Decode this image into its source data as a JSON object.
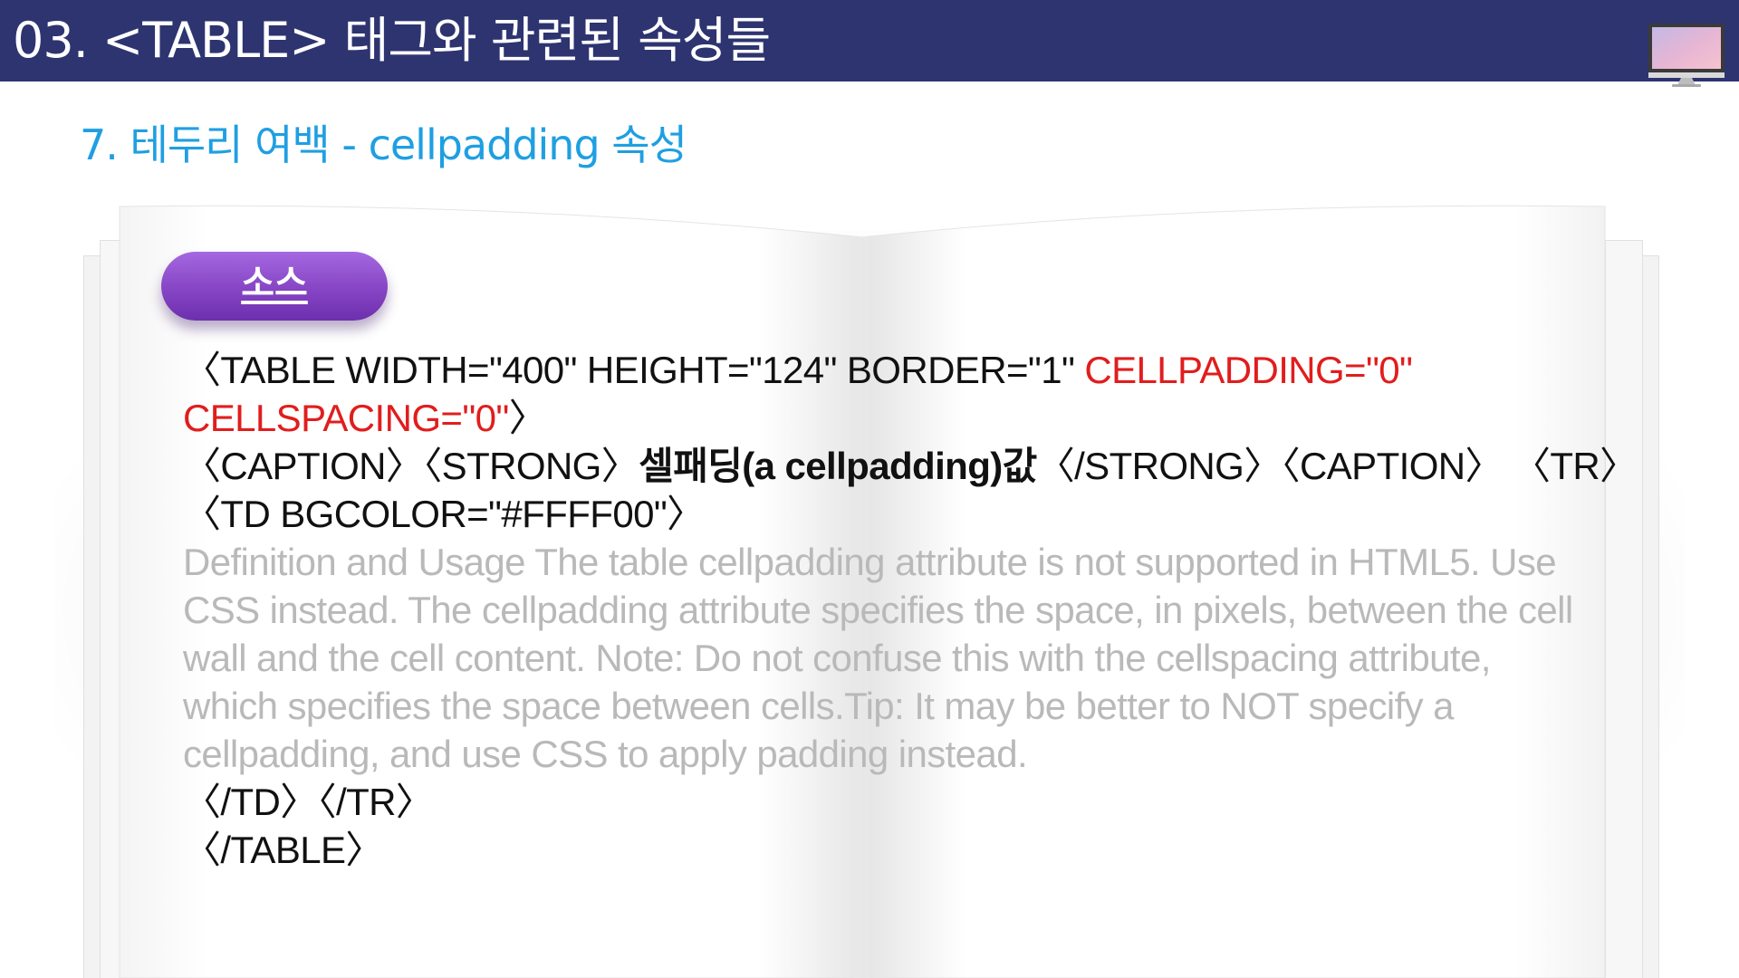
{
  "header": {
    "title": "03. <TABLE> 태그와 관련된 속성들",
    "icon": "monitor-icon",
    "color": "#2e3470"
  },
  "subtitle": "7. 테두리 여백 - cellpadding 속성",
  "badge": {
    "label": "소스"
  },
  "code": {
    "line1_black": "〈TABLE WIDTH=\"400\" HEIGHT=\"124\" BORDER=\"1\" ",
    "line1_red": "CELLPADDING=\"0\"",
    "line2_red": "CELLSPACING=\"0\"",
    "line2_black": "〉",
    "line3_a": "〈CAPTION〉〈STRONG〉",
    "line3_bold": "셀패딩(a cellpadding)값",
    "line3_b": "〈/STRONG〉〈CAPTION〉 〈TR〉",
    "line4": "〈TD BGCOLOR=\"#FFFF00\"〉",
    "description": "Definition and Usage The table cellpadding attribute is not supported in HTML5. Use CSS instead. The cellpadding attribute specifies the space, in pixels, between the cell wall and the cell content. Note: Do not confuse this with the cellspacing attribute, which specifies the space between cells.Tip: It may be better to NOT specify a cellpadding, and use CSS to apply padding instead.",
    "line_close_td": "〈/TD〉〈/TR〉",
    "line_close_table": "〈/TABLE〉"
  },
  "colors": {
    "accent": "#1f9fe2",
    "highlight": "#e11d1d",
    "badge": "#8645c4",
    "muted_text": "#b9b9b9"
  }
}
